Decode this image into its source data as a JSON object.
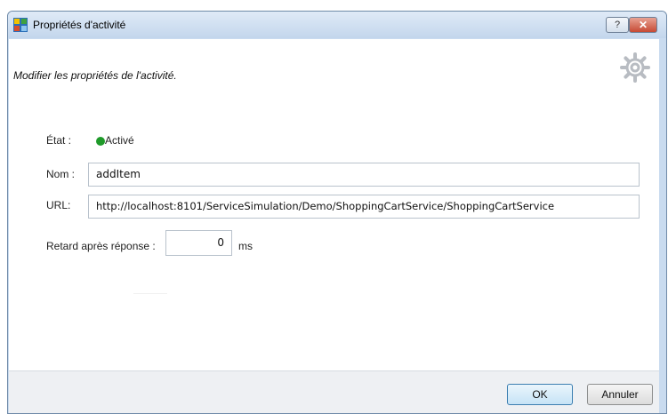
{
  "window": {
    "title": "Propriétés d'activité",
    "help_label": "?",
    "close_label": "✕"
  },
  "header": {
    "subtitle": "Modifier les propriétés de l'activité."
  },
  "form": {
    "state_label": "État :",
    "state_value": "Activé",
    "state_color": "#1f9a2a",
    "name_label": "Nom :",
    "name_value": "addItem",
    "url_label": "URL:",
    "url_value": "http://localhost:8101/ServiceSimulation/Demo/ShoppingCartService/ShoppingCartService",
    "delay_label": "Retard après réponse :",
    "delay_value": "0",
    "delay_unit": "ms"
  },
  "footer": {
    "ok_label": "OK",
    "cancel_label": "Annuler"
  },
  "icons": {
    "app": "activity-app-icon",
    "header": "gear-icon"
  }
}
